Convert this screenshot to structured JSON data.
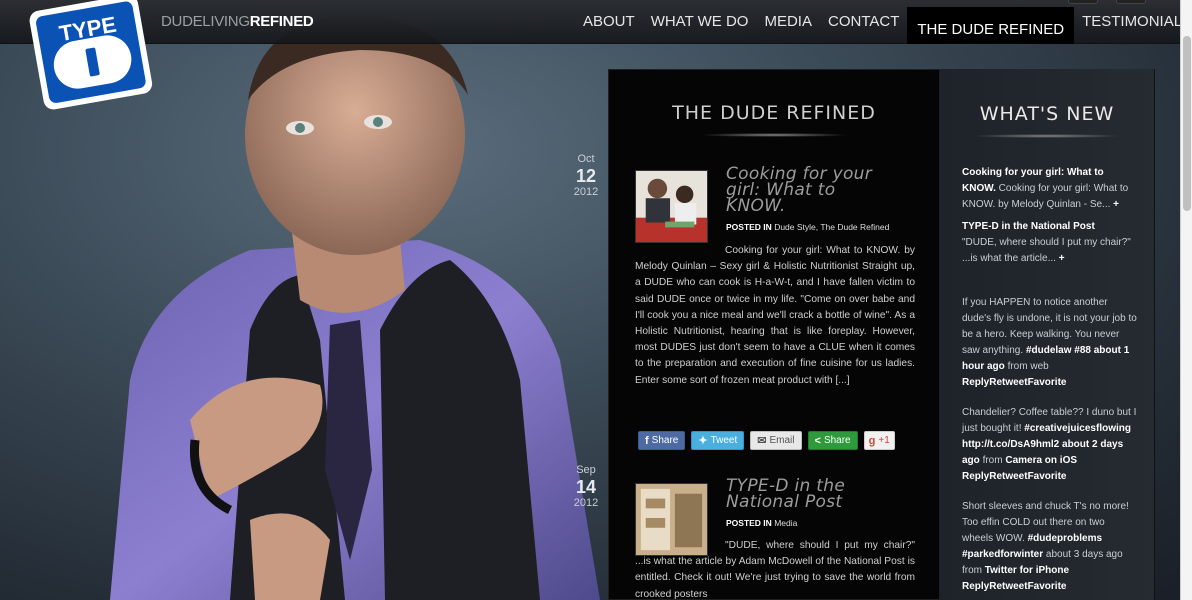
{
  "brand": {
    "part1": "DUDELIVING",
    "part2": "REFINED",
    "logo_text": "TYPE"
  },
  "nav": {
    "items": [
      "ABOUT",
      "WHAT WE DO",
      "MEDIA",
      "CONTACT",
      "THE DUDE REFINED",
      "TESTIMONIALS"
    ],
    "active": "THE DUDE REFINED"
  },
  "main": {
    "title": "THE DUDE REFINED"
  },
  "posts": [
    {
      "month": "Oct",
      "day": "12",
      "year": "2012",
      "title": "Cooking for your girl: What to KNOW.",
      "posted_label": "POSTED IN",
      "categories": "Dude Style, The Dude Refined",
      "excerpt": "Cooking for your girl: What to KNOW. by Melody Quinlan – Sexy girl & Holistic Nutritionist Straight up, a DUDE who can cook is H-a-W-t, and I have fallen victim to said DUDE once or twice in my life. \"Come on over babe and I'll cook you a nice meal and we'll crack a bottle of wine\". As a Holistic Nutritionist, hearing that is like foreplay. However, most DUDES just don't seem to have a CLUE when it comes to the preparation and execution of fine cuisine for us ladies. Enter some sort of frozen meat product with [...]"
    },
    {
      "month": "Sep",
      "day": "14",
      "year": "2012",
      "title": "TYPE-D in the National Post",
      "posted_label": "POSTED IN",
      "categories": "Media",
      "excerpt": "\"DUDE, where should I put my chair?\" ...is what the article by Adam McDowell of the National Post is entitled. Check it out! We're just trying to save the world from crooked posters"
    }
  ],
  "share": {
    "facebook": "Share",
    "twitter": "Tweet",
    "email": "Email",
    "share": "Share",
    "gplus": "+1"
  },
  "sidebar": {
    "title": "WHAT'S NEW",
    "news": [
      {
        "title": "Cooking for your girl: What to KNOW.",
        "text": "Cooking for your girl: What to KNOW. by Melody Quinlan - Se...",
        "more": "+"
      },
      {
        "title": "TYPE-D in the National Post",
        "text": "\"DUDE, where should I put my chair?\" ...is what the article...",
        "more": "+"
      }
    ],
    "tweets": [
      {
        "text": "If you HAPPEN to notice another dude's fly is undone, it is not your job to be a hero. Keep walking. You never saw anything.",
        "tag": "#dudelaw #88",
        "time": "about 1 hour ago",
        "from": "from",
        "source": "web",
        "actions": "ReplyRetweetFavorite"
      },
      {
        "text": "Chandelier? Coffee table?? I duno but I just bought it!",
        "tag": "#creativejuicesflowing http://t.co/DsA9hml2",
        "time": "about 2 days ago",
        "from": "from",
        "source": "Camera on iOS",
        "actions": "ReplyRetweetFavorite"
      },
      {
        "text": "Short sleeves and chuck T's no more! Too effin COLD out there on two wheels WOW.",
        "tag": "#dudeproblems #parkedforwinter",
        "time": "about 3 days ago",
        "from": "from",
        "source": "Twitter for iPhone",
        "actions": "ReplyRetweetFavorite"
      }
    ]
  }
}
